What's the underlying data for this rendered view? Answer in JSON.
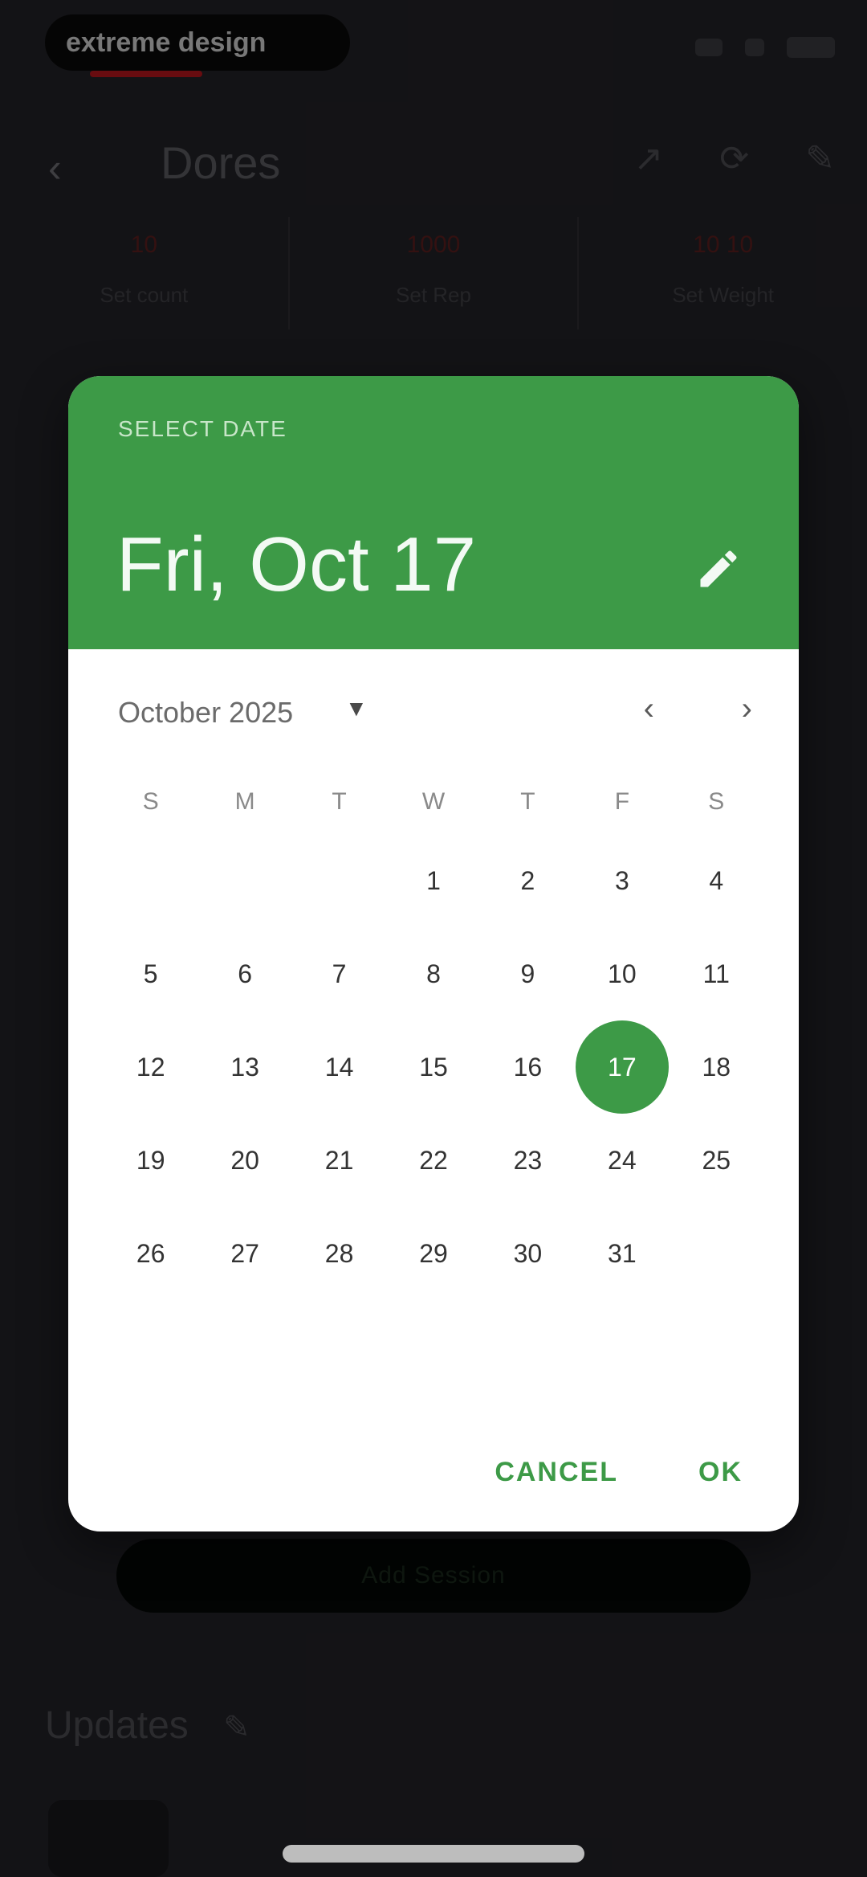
{
  "status_bar": {
    "logo_text": "extreme design"
  },
  "app_bar": {
    "title": "Dores"
  },
  "stats": [
    {
      "value": "10",
      "label": "Set count"
    },
    {
      "value": "1000",
      "label": "Set Rep"
    },
    {
      "value": "10 10",
      "label": "Set Weight"
    }
  ],
  "background": {
    "button_label": "Add Session",
    "section_title": "Updates"
  },
  "dialog": {
    "header_label": "SELECT DATE",
    "selected_date": "Fri, Oct 17",
    "month_label": "October 2025",
    "weekdays": [
      "S",
      "M",
      "T",
      "W",
      "T",
      "F",
      "S"
    ],
    "weeks": [
      [
        "",
        "",
        "",
        "1",
        "2",
        "3",
        "4"
      ],
      [
        "5",
        "6",
        "7",
        "8",
        "9",
        "10",
        "11"
      ],
      [
        "12",
        "13",
        "14",
        "15",
        "16",
        "17",
        "18"
      ],
      [
        "19",
        "20",
        "21",
        "22",
        "23",
        "24",
        "25"
      ],
      [
        "26",
        "27",
        "28",
        "29",
        "30",
        "31",
        ""
      ]
    ],
    "selected_day": "17",
    "cancel_label": "CANCEL",
    "ok_label": "OK"
  },
  "colors": {
    "accent": "#3d9a47",
    "scrim": "#000000",
    "surface": "#ffffff"
  },
  "icons": {
    "back": "arrow-left-icon",
    "edit": "pencil-icon",
    "dropdown": "caret-down-icon",
    "prev_month": "chevron-left-icon",
    "next_month": "chevron-right-icon"
  }
}
